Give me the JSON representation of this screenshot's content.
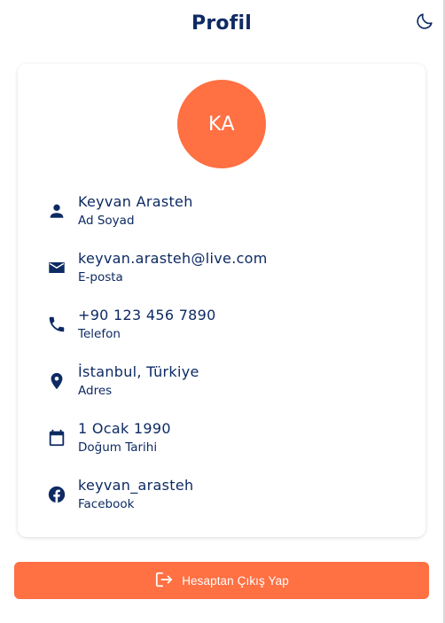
{
  "header": {
    "title": "Profil",
    "theme_toggle_icon": "moon-icon"
  },
  "profile": {
    "initials": "KA",
    "avatar_color": "#ff7043"
  },
  "info": [
    {
      "icon": "person-icon",
      "value": "Keyvan Arasteh",
      "label": "Ad Soyad"
    },
    {
      "icon": "mail-icon",
      "value": "keyvan.arasteh@live.com",
      "label": "E-posta"
    },
    {
      "icon": "phone-icon",
      "value": "+90 123 456 7890",
      "label": "Telefon"
    },
    {
      "icon": "location-pin-icon",
      "value": "İstanbul, Türkiye",
      "label": "Adres"
    },
    {
      "icon": "calendar-icon",
      "value": "1 Ocak 1990",
      "label": "Doğum Tarihi"
    },
    {
      "icon": "facebook-icon",
      "value": "keyvan_arasteh",
      "label": "Facebook"
    }
  ],
  "logout": {
    "label": "Hesaptan Çıkış Yap",
    "icon": "logout-icon",
    "color": "#ff7043"
  },
  "colors": {
    "primary_text": "#0d2a63",
    "accent": "#ff7043"
  }
}
